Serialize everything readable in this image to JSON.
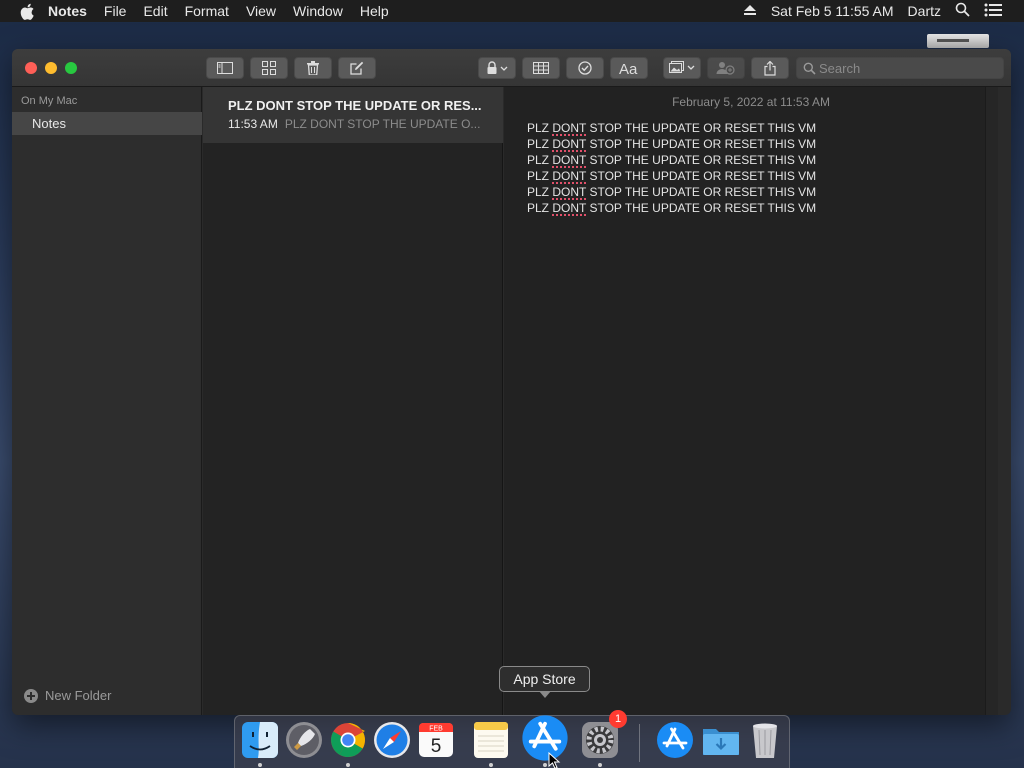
{
  "menubar": {
    "items": [
      "Notes",
      "File",
      "Edit",
      "Format",
      "View",
      "Window",
      "Help"
    ],
    "datetime": "Sat Feb 5  11:55 AM",
    "user": "Dartz"
  },
  "window": {
    "search_placeholder": "Search"
  },
  "sidebar": {
    "header": "On My Mac",
    "folders": [
      {
        "label": "Notes",
        "selected": true
      }
    ],
    "new_folder_label": "New Folder"
  },
  "notelist": {
    "notes": [
      {
        "title": "PLZ DONT STOP THE UPDATE OR RES...",
        "time": "11:53 AM",
        "preview": "PLZ DONT STOP THE UPDATE O..."
      }
    ]
  },
  "editor": {
    "date": "February 5, 2022 at 11:53 AM",
    "lines": [
      {
        "before": "PLZ ",
        "misspelled": "DONT",
        "after": " STOP THE UPDATE OR RESET THIS VM"
      },
      {
        "before": "PLZ ",
        "misspelled": "DONT",
        "after": " STOP THE UPDATE OR RESET THIS VM"
      },
      {
        "before": "PLZ ",
        "misspelled": "DONT",
        "after": " STOP THE UPDATE OR RESET THIS VM"
      },
      {
        "before": "PLZ ",
        "misspelled": "DONT",
        "after": " STOP THE UPDATE OR RESET THIS VM"
      },
      {
        "before": "PLZ ",
        "misspelled": "DONT",
        "after": " STOP THE UPDATE OR RESET THIS VM"
      },
      {
        "before": "PLZ ",
        "misspelled": "DONT",
        "after": " STOP THE UPDATE OR RESET THIS VM"
      }
    ]
  },
  "dock": {
    "tooltip": "App Store",
    "apps": [
      "finder-icon",
      "launchpad-icon",
      "chrome-icon",
      "safari-icon",
      "calendar-icon",
      "notes-icon",
      "app-store-icon",
      "system-preferences-icon",
      "app-store-icon",
      "downloads-folder-icon",
      "trash-icon"
    ],
    "calendar": {
      "month": "FEB",
      "day": "5"
    },
    "system_preferences_badge": "1"
  },
  "colors": {
    "close": "#fe5f57",
    "minimize": "#febc2e",
    "maximize": "#28c840",
    "badge": "#ff3b30",
    "spelling_underline": "#e0506a"
  }
}
